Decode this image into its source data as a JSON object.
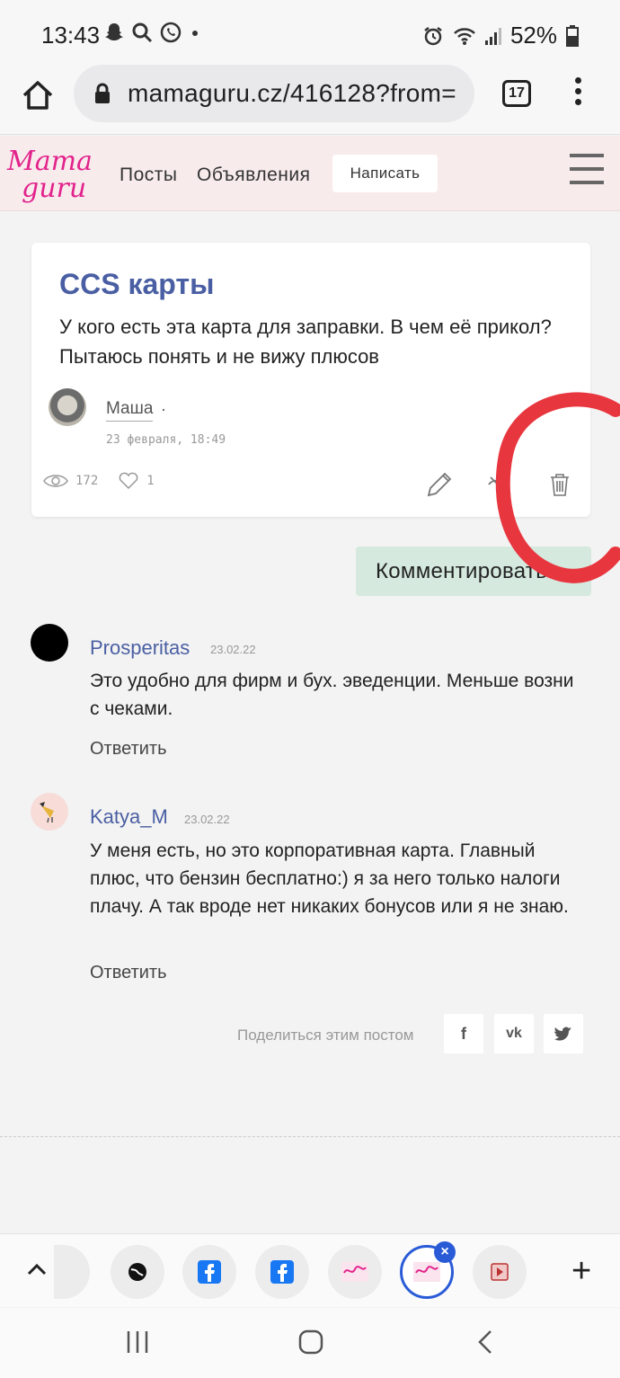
{
  "status_bar": {
    "time": "13:43",
    "battery": "52%",
    "icons": [
      "alarm-icon",
      "wifi-icon",
      "signal-icon",
      "battery-icon",
      "snapchat-icon",
      "search-icon",
      "whatsapp-icon",
      "dot-icon"
    ]
  },
  "browser": {
    "url": "mamaguru.cz/416128?from=",
    "tab_count": "17"
  },
  "site_header": {
    "nav_posts": "Посты",
    "nav_ads": "Объявления",
    "write_button": "Написать"
  },
  "post": {
    "title": "CCS карты",
    "body": "У кого есть эта карта для заправки. В чем её прикол? Пытаюсь понять и не вижу плюсов",
    "author": "Маша",
    "author_dot": "·",
    "date": "23 февраля, 18:49",
    "views": "172",
    "likes": "1"
  },
  "comment_button": "Комментировать",
  "comments": [
    {
      "name": "Prosperitas",
      "date": "23.02.22",
      "text": "Это удобно для фирм и бух. эведенции. Меньше возни с чеками.",
      "reply": "Ответить"
    },
    {
      "name": "Katya_M",
      "date": "23.02.22",
      "text": "У меня есть, но это корпоративная карта. Главный плюс, что бензин бесплатно:) я за него только налоги плачу. А так вроде нет никаких бонусов или я не знаю.",
      "reply": "Ответить"
    }
  ],
  "share": {
    "label": "Поделиться этим постом",
    "facebook": "f",
    "vk": "vk",
    "twitter": "twitter-icon"
  },
  "colors": {
    "accent": "#4a5fa3",
    "header_bg": "#f8ebec",
    "comment_button_bg": "#d5e9df",
    "annotation": "#e8363f"
  }
}
